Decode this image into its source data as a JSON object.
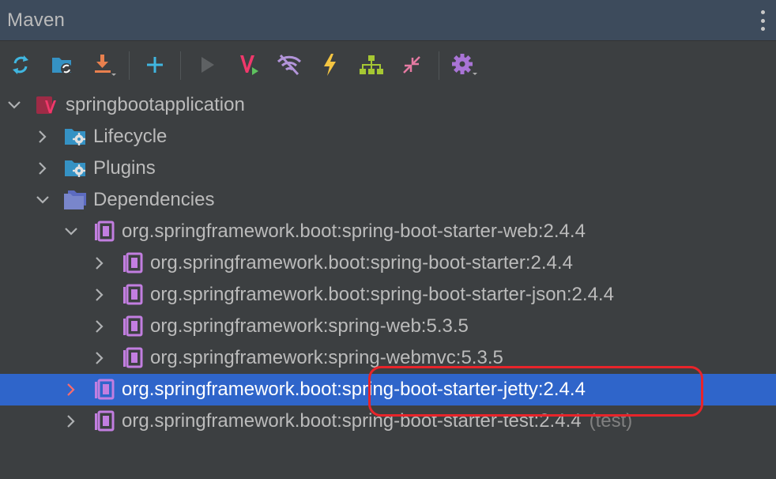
{
  "panel": {
    "title": "Maven"
  },
  "toolbar": {
    "buttons": [
      {
        "name": "reload-icon"
      },
      {
        "name": "reload-project-icon"
      },
      {
        "name": "download-icon"
      },
      {
        "name": "add-icon"
      },
      {
        "name": "run-icon"
      },
      {
        "name": "execute-maven-goal-icon"
      },
      {
        "name": "toggle-offline-icon"
      },
      {
        "name": "skip-tests-icon"
      },
      {
        "name": "show-dependencies-icon"
      },
      {
        "name": "collapse-all-icon"
      },
      {
        "name": "settings-icon"
      }
    ]
  },
  "tree": {
    "root": "springbootapplication",
    "lifecycle": "Lifecycle",
    "plugins": "Plugins",
    "dependencies": "Dependencies",
    "deps": [
      "org.springframework.boot:spring-boot-starter-web:2.4.4",
      "org.springframework.boot:spring-boot-starter:2.4.4",
      "org.springframework.boot:spring-boot-starter-json:2.4.4",
      "org.springframework:spring-web:5.3.5",
      "org.springframework:spring-webmvc:5.3.5",
      "org.springframework.boot:spring-boot-starter-jetty:2.4.4",
      "org.springframework.boot:spring-boot-starter-test:2.4.4"
    ],
    "test_suffix": "(test)"
  },
  "colors": {
    "selected_row": "#2f65ca",
    "highlight_border": "#e8242a",
    "header_bg": "#3d4b5c",
    "panel_bg": "#3c3f41"
  }
}
